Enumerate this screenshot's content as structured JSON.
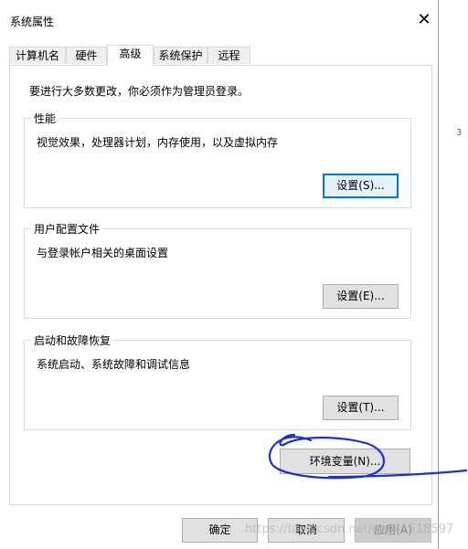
{
  "window": {
    "title": "系统属性",
    "close_symbol": "✕"
  },
  "tabs": [
    {
      "label": "计算机名",
      "active": false
    },
    {
      "label": "硬件",
      "active": false
    },
    {
      "label": "高级",
      "active": true
    },
    {
      "label": "系统保护",
      "active": false
    },
    {
      "label": "远程",
      "active": false
    }
  ],
  "advanced": {
    "admin_note": "要进行大多数更改，你必须作为管理员登录。",
    "performance": {
      "title": "性能",
      "description": "视觉效果，处理器计划，内存使用，以及虚拟内存",
      "button": "设置(S)..."
    },
    "user_profiles": {
      "title": "用户配置文件",
      "description": "与登录帐户相关的桌面设置",
      "button": "设置(E)..."
    },
    "startup_recovery": {
      "title": "启动和故障恢复",
      "description": "系统启动、系统故障和调试信息",
      "button": "设置(T)..."
    },
    "env_button": "环境变量(N)..."
  },
  "footer": {
    "ok": "确定",
    "cancel": "取消",
    "apply": "应用(A)"
  },
  "watermark": "https://blog.csdn.net/qq_41518597",
  "edge_mark": "3",
  "colors": {
    "focus_border": "#0078d7",
    "annotation_ink": "#1a2fd6",
    "window_edge": "#e07a7a"
  }
}
